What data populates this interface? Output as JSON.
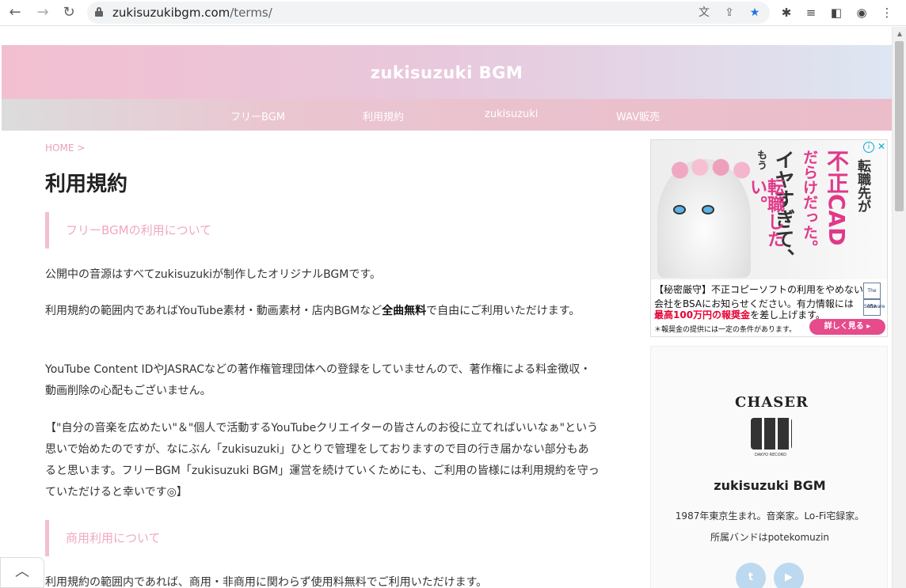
{
  "browser": {
    "url_domain": "zukisuzukibgm.com",
    "url_path": "/terms/",
    "back_icon": "arrow-left-icon",
    "forward_icon": "arrow-right-icon",
    "reload_icon": "reload-icon"
  },
  "site": {
    "title": "zukisuzuki BGM",
    "nav": [
      "フリーBGM",
      "利用規約",
      "zukisuzuki",
      "WAV販売"
    ]
  },
  "main": {
    "breadcrumb": "HOME >",
    "title": "利用規約",
    "section1_heading": "フリーBGMの利用について",
    "p1": "公開中の音源はすべてzukisuzukiが制作したオリジナルBGMです。",
    "p2_before": "利用規約の範囲内であればYouTube素材・動画素材・店内BGMなど",
    "p2_bold": "全曲無料",
    "p2_after": "で自由にご利用いただけます。",
    "p3": "YouTube Content IDやJASRACなどの著作権管理団体への登録をしていませんので、著作権による料金徴収・動画削除の心配もございません。",
    "p4": "【\"自分の音楽を広めたい\"＆\"個人で活動するYouTubeクリエイターの皆さんのお役に立てればいいなぁ\"という思いで始めたのですが、なにぶん「zukisuzuki」ひとりで管理をしておりますので目の行き届かない部分もあると思います。フリーBGM「zukisuzuki BGM」運営を続けていくためにも、ご利用の皆様には利用規約を守っていただけると幸いです◎】",
    "section2_heading": "商用利用について",
    "p5": "利用規約の範囲内であれば、商用・非商用に関わらず使用料無料でご利用いただけます。"
  },
  "ad": {
    "vertical_1": "不正CAD",
    "vertical_2": "だらけだった。",
    "vertical_3": "転職先が",
    "vertical_4": "イヤすぎて、",
    "vertical_5": "もう",
    "vertical_6": "転職したい。",
    "line1": "【秘密厳守】不正コピーソフトの利用をやめない",
    "line2": "会社をBSAにお知らせください。有力情報には",
    "line3_red": "最高100万円の報奨金",
    "line3_after": "を差し上げます。",
    "note": "＊報奨金の提供には一定の条件があります。",
    "cta": "詳しく見る ▸",
    "bsa_label_1": "The Software Alliance",
    "bsa_label_2": "BSA",
    "accent": "#e64b8c"
  },
  "profile": {
    "logo_text": "CHASER",
    "logo_sub": "DAKYO RECORD",
    "name": "zukisuzuki BGM",
    "line1": "1987年東京生まれ。音楽家。Lo-Fi宅録家。",
    "line2": "所属バンドはpotekomuzin",
    "social_1": "twitter-icon",
    "social_2": "youtube-icon"
  },
  "colors": {
    "accent_pink": "#f0a8bf",
    "brand_pink": "#f2bfd0"
  }
}
